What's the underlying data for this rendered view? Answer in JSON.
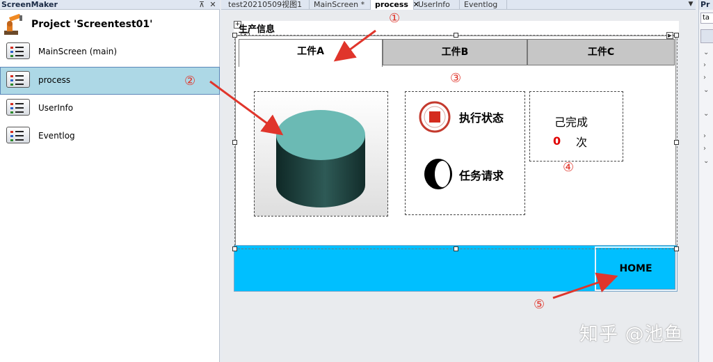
{
  "left_panel": {
    "title": "ScreenMaker",
    "pin_glyph": "⊼",
    "close_glyph": "✕",
    "project_label": "Project 'Screentest01'",
    "items": [
      {
        "label": "MainScreen (main)"
      },
      {
        "label": "process",
        "selected": true
      },
      {
        "label": "UserInfo"
      },
      {
        "label": "Eventlog"
      }
    ]
  },
  "tabs": [
    {
      "label": "test20210509视图1"
    },
    {
      "label": "MainScreen *"
    },
    {
      "label": "process",
      "active": true
    },
    {
      "label": "UserInfo"
    },
    {
      "label": "Eventlog"
    }
  ],
  "tab_close_glyph": "✕",
  "tab_menu_glyph": "▼",
  "canvas": {
    "production_label": "生产信息",
    "tab_control": {
      "tabs": [
        {
          "label": "工件A",
          "active": true
        },
        {
          "label": "工件B"
        },
        {
          "label": "工件C"
        }
      ]
    },
    "status": {
      "exec_label": "执行状态",
      "request_label": "任务请求"
    },
    "completed": {
      "label": "己完成",
      "count": "0",
      "unit": "次"
    },
    "home_button": "HOME"
  },
  "annotations": [
    "①",
    "②",
    "③",
    "④",
    "⑤"
  ],
  "right_panel": {
    "title": "Pr",
    "field": "ta"
  },
  "watermark": "知乎 @池鱼",
  "colors": {
    "accent_blue": "#00bfff",
    "selected_row": "#add8e6",
    "annotation_red": "#e0352b",
    "cylinder_top": "#6bbab4",
    "cylinder_body": "#1e3a38",
    "status_red": "#d42b1e",
    "count_red": "#e00000"
  },
  "icons": {
    "project": "robot-arm-icon",
    "screen": "screen-list-icon",
    "status": "stop-indicator-icon",
    "request": "toggle-switch-icon"
  }
}
